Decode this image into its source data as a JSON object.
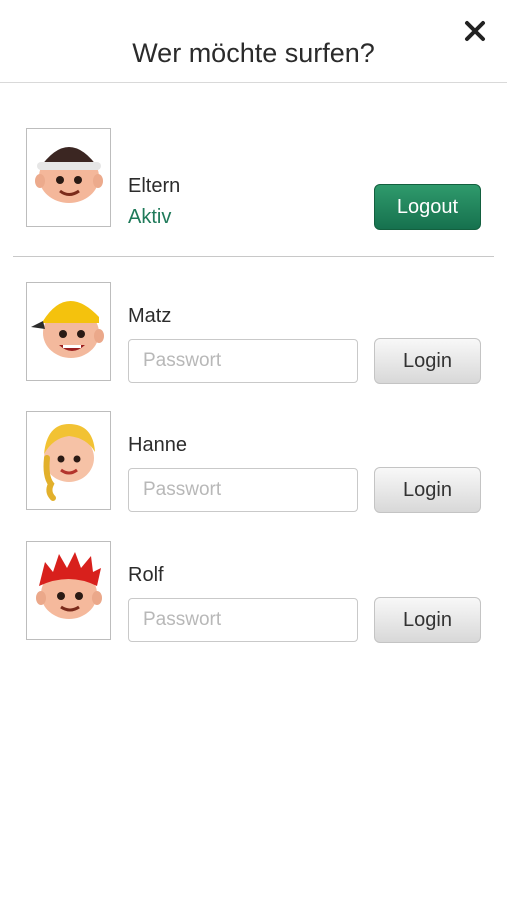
{
  "header": {
    "title": "Wer möchte surfen?",
    "close_icon": "close-icon"
  },
  "parent": {
    "name": "Eltern",
    "status": "Aktiv",
    "button_label": "Logout",
    "avatar": "boy-beanie-avatar"
  },
  "children": [
    {
      "name": "Matz",
      "placeholder": "Passwort",
      "button_label": "Login",
      "avatar": "boy-yellow-cap-avatar"
    },
    {
      "name": "Hanne",
      "placeholder": "Passwort",
      "button_label": "Login",
      "avatar": "girl-blonde-braid-avatar"
    },
    {
      "name": "Rolf",
      "placeholder": "Passwort",
      "button_label": "Login",
      "avatar": "boy-red-hair-avatar"
    }
  ],
  "colors": {
    "accent": "#1f7a5a",
    "logout_button": "#1a7a55"
  }
}
